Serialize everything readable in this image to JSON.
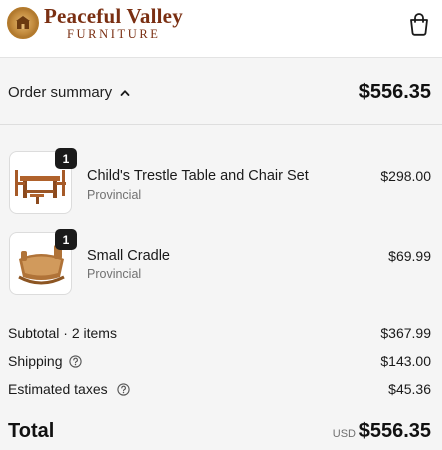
{
  "header": {
    "brand_line1": "Peaceful Valley",
    "brand_line2": "FURNITURE",
    "cart_icon": "shopping-bag-icon"
  },
  "summary": {
    "label": "Order summary",
    "toggle_icon": "chevron-up-icon",
    "total": "$556.35"
  },
  "items": [
    {
      "name": "Child's Trestle Table and Chair Set",
      "variant": "Provincial",
      "price": "$298.00",
      "quantity": "1"
    },
    {
      "name": "Small Cradle",
      "variant": "Provincial",
      "price": "$69.99",
      "quantity": "1"
    }
  ],
  "totals": {
    "subtotal_label": "Subtotal · 2 items",
    "subtotal_value": "$367.99",
    "shipping_label": "Shipping",
    "shipping_value": "$143.00",
    "taxes_label": "Estimated taxes",
    "taxes_value": "$45.36",
    "total_label": "Total",
    "currency": "USD",
    "total_value": "$556.35"
  },
  "colors": {
    "brand": "#7a2f12",
    "badge": "#1a1a1a",
    "background": "#f5f5f5"
  }
}
